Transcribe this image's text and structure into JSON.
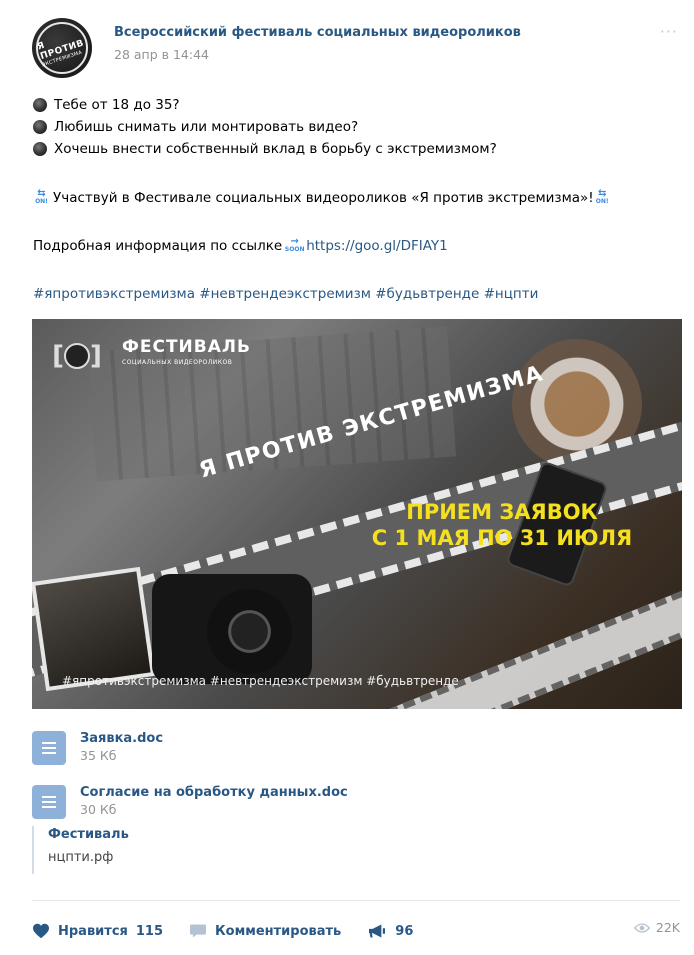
{
  "post": {
    "author": "Всероссийский фестиваль социальных видеороликов",
    "date": "28 апр в 14:44",
    "avatar_line1": "Я ПРОТИВ",
    "avatar_line2": "ЭКСТРЕМИЗМА",
    "more": "···",
    "bullets": [
      "Тебе от 18 до 35?",
      "Любишь снимать или монтировать видео?",
      "Хочешь внести собственный вклад в борьбу с экстремизмом?"
    ],
    "emoji_on_text": "ON!",
    "emoji_soon_text": "SOON",
    "participate": "Участвуй в Фестивале социальных видеороликов «Я против экстремизма»!",
    "info_text": "Подробная информация по ссылке",
    "info_link": "https://goo.gl/DFIAY1",
    "hashtags": "#япротивэкстремизма #невтрендеэкстремизм #будьвтренде #нцпти"
  },
  "banner": {
    "title": "ФЕСТИВАЛЬ",
    "subtitle": "СОЦИАЛЬНЫХ ВИДЕОРОЛИКОВ",
    "slogan": "Я ПРОТИВ ЭКСТРЕМИЗМА",
    "reception_line1": "ПРИЕМ ЗАЯВОК",
    "reception_line2": "С 1 МАЯ ПО 31 ИЮЛЯ",
    "tags": "#япротивэкстремизма #невтрендеэкстремизм #будьвтренде"
  },
  "attachments": [
    {
      "name": "Заявка.doc",
      "size": "35 Кб"
    },
    {
      "name": "Согласие на обработку данных.doc",
      "size": "30 Кб"
    }
  ],
  "link": {
    "title": "Фестиваль",
    "url": "нцпти.рф"
  },
  "actions": {
    "like_label": "Нравится",
    "like_count": "115",
    "comment_label": "Комментировать",
    "share_count": "96",
    "views": "22K"
  },
  "colors": {
    "link": "#2a5885",
    "muted": "#939393",
    "banner_accent": "#f5e020"
  },
  "icons": [
    "radio-icon",
    "on-arrows-icon",
    "soon-arrow-icon",
    "document-icon",
    "heart-icon",
    "comment-icon",
    "megaphone-icon",
    "eye-icon"
  ]
}
